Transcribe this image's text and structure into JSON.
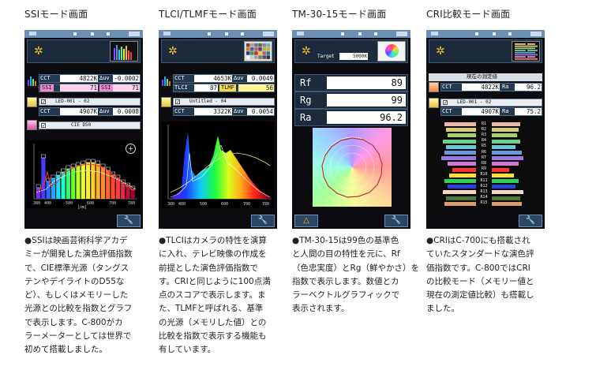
{
  "columns": [
    {
      "id": "ssi",
      "title": "SSIモード画面",
      "screen": {
        "status_mode": " ",
        "cct_label": "CCT",
        "cct_value": "4822K",
        "duv_label": "∆uv",
        "duv_value": "-0.0002",
        "ssi_label": "SSI",
        "ssi_value1": "71",
        "ssi_label2": "SSI",
        "ssi_value2": "71",
        "mem_label": "LED-001 - 02",
        "cct2_label": "CCT",
        "cct2_value": "4907K",
        "duv2_label": "∆uv",
        "duv2_value": "0.0008",
        "ref_label": "CIE D50",
        "chart_x_ticks": [
          "380",
          "400",
          "500",
          "600",
          "700",
          "780"
        ],
        "chart_unit": "[nm]"
      },
      "description": [
        "●SSIは映画芸術科学アカデ",
        "ミーが開発した演色評価指数",
        "で、CIE標準光源（タングス",
        "テンやデイライトのD55な",
        "ど）、もしくはメモリーした",
        "光源との比較を指数とグラフ",
        "で表示します。C-800がカ",
        "ラーメーターとしては世界で",
        "初めて搭載しました。"
      ]
    },
    {
      "id": "tlci",
      "title": "TLCI/TLMFモード画面",
      "screen": {
        "cct_label": "CCT",
        "cct_value": "4653K",
        "duv_label": "∆uv",
        "duv_value": "0.0049",
        "tlci_label": "TLCI",
        "tlci_value": "87",
        "tlmf_label": "TLMF",
        "tlmf_value": "56",
        "mem_label": "Untitled - 04",
        "cct2_label": "CCT",
        "cct2_value": "3322K",
        "duv2_label": "∆uv",
        "duv2_value": "0.0054",
        "chart_x_ticks": [
          "380",
          "400",
          "500",
          "600",
          "700",
          "780"
        ]
      },
      "description": [
        "●TLCIはカメラの特性を演算",
        "に入れ、テレビ映像の作成を",
        "前提とした演色評価指数で",
        "す。CRIと同じように100点満",
        "点のスコアで表示します。ま",
        "た、TLMFと呼ばれる、基準",
        "の光源（メモリした値）との",
        "比較を指数で表示する機能も",
        "有しています。"
      ]
    },
    {
      "id": "tm30",
      "title": "TM-30-15モード画面",
      "screen": {
        "target_label": "Target",
        "target_value": "5000K",
        "rf_label": "Rf",
        "rf_value": "89",
        "rg_label": "Rg",
        "rg_value": "99",
        "ra_label": "Ra",
        "ra_value": "96.2"
      },
      "description": [
        "●TM-30-15は99色の基準色",
        "と人間の目の特性を元に、Rf",
        "（色忠実度）とRg（鮮やかさ）を",
        "指数で表示します。数値とカ",
        "ラーベクトルグラフィックで",
        "表示されます。"
      ]
    },
    {
      "id": "cri",
      "title": "CRI比較モード画面",
      "screen": {
        "header_label": "現在の測定値",
        "cct_label": "CCT",
        "cct_value": "4822K",
        "ra_label": "Ra",
        "ra_value": "96.2",
        "mem_label": "LED-001 - 02",
        "cct2_label": "CCT",
        "cct2_value": "4907K",
        "ra2_label": "Ra",
        "ra2_value": "75.2",
        "rows": [
          "R1",
          "R2",
          "R3",
          "R4",
          "R5",
          "R6",
          "R7",
          "R8",
          "R9",
          "R10",
          "R11",
          "R12",
          "R13",
          "R14",
          "R15"
        ]
      },
      "description": [
        "●CRIはC-700にも搭載され",
        "ていたスタンダードな演色評",
        "価指数です。C-800ではCRI",
        "の比較モード（メモリー値と",
        "現在の測定値比較）も搭載し",
        "ました。"
      ]
    }
  ],
  "colors": {
    "screen_bg": "#0c0c10",
    "status_bar": "#6d8fb6",
    "pink_field": "#ffd2ec",
    "yellow_field": "#fff59a",
    "sun": "#f2c01a"
  },
  "icons": [
    "sun-icon",
    "wrench-icon",
    "magnify-plus-icon",
    "bluetooth-icon",
    "battery-icon",
    "triangle-icon",
    "checkbox-icon"
  ]
}
